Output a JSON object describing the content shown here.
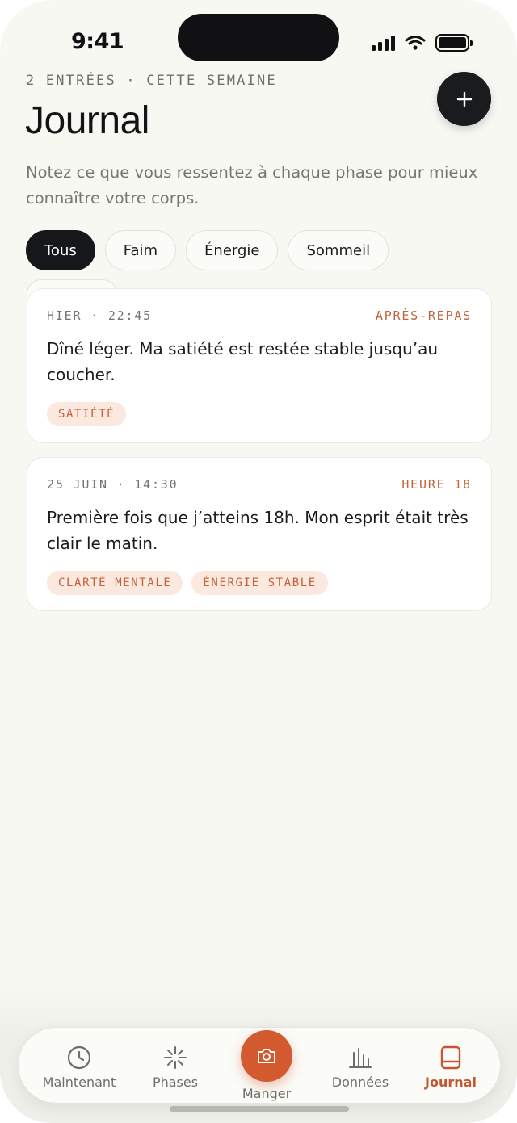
{
  "status": {
    "time": "9:41"
  },
  "header": {
    "eyebrow": "2 ENTRÉES · CETTE SEMAINE",
    "title": "Journal",
    "subtitle": "Notez ce que vous ressentez à chaque phase pour mieux connaître votre corps.",
    "add_icon": "plus-icon"
  },
  "filters": [
    {
      "label": "Tous",
      "active": true
    },
    {
      "label": "Faim",
      "active": false
    },
    {
      "label": "Énergie",
      "active": false
    },
    {
      "label": "Sommeil",
      "active": false
    }
  ],
  "entries": [
    {
      "date": "HIER · 22:45",
      "phase": "APRÈS-REPAS",
      "text": "Dîné léger. Ma satiété est restée stable jusqu’au coucher.",
      "tags": [
        "SATIÉTÉ"
      ]
    },
    {
      "date": "25 JUIN · 14:30",
      "phase": "HEURE 18",
      "text": "Première fois que j’atteins 18h. Mon esprit était très clair le matin.",
      "tags": [
        "CLARTÉ MENTALE",
        "ÉNERGIE STABLE"
      ]
    }
  ],
  "nav": {
    "items": [
      {
        "label": "Maintenant",
        "icon": "clock-icon"
      },
      {
        "label": "Phases",
        "icon": "sparkle-icon"
      },
      {
        "label": "Manger",
        "icon": "camera-icon"
      },
      {
        "label": "Données",
        "icon": "bar-chart-icon"
      },
      {
        "label": "Journal",
        "icon": "book-icon"
      }
    ],
    "active": "Journal"
  },
  "colors": {
    "accent": "#d35a2e",
    "dark": "#16171b",
    "background": "#f8f8f3",
    "tag_bg": "#fbe8df"
  }
}
